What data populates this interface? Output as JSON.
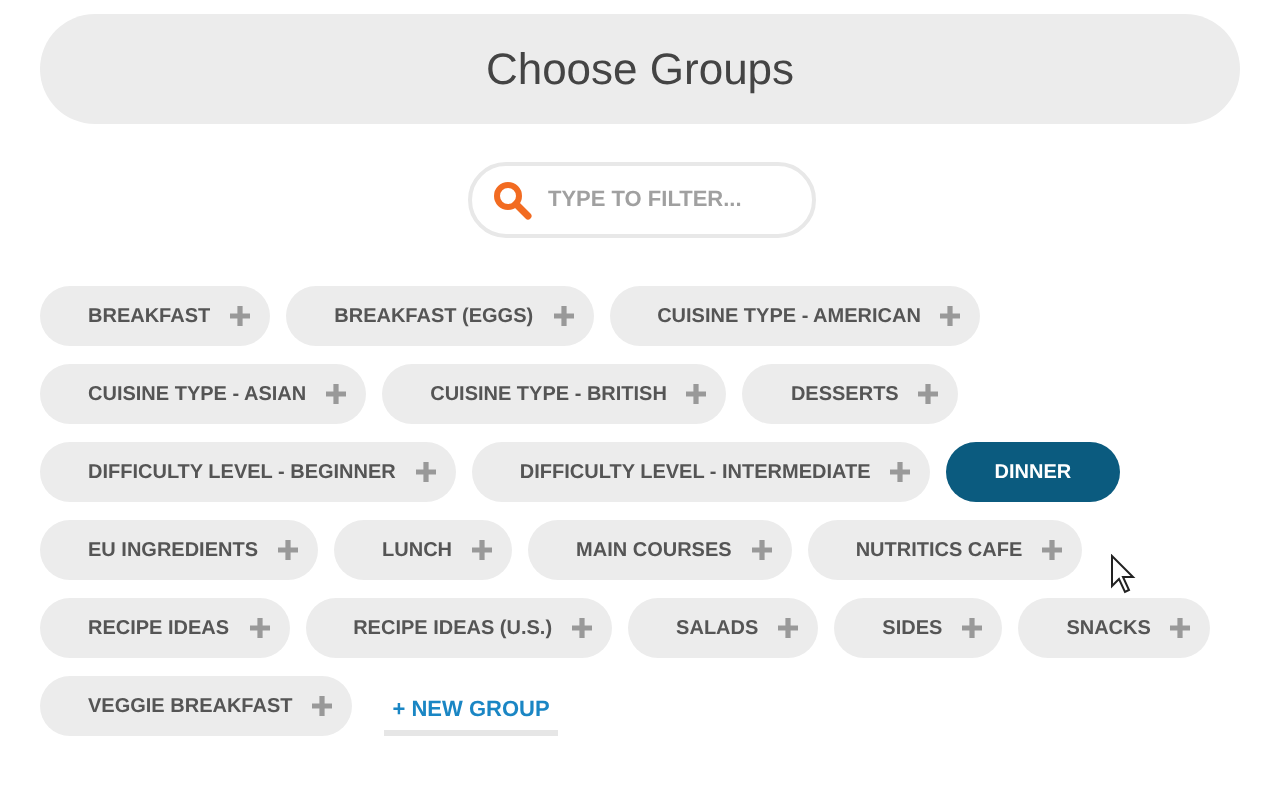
{
  "header": {
    "title": "Choose Groups"
  },
  "filter": {
    "placeholder": "TYPE TO FILTER..."
  },
  "groups": [
    {
      "label": "BREAKFAST",
      "selected": false
    },
    {
      "label": "BREAKFAST (EGGS)",
      "selected": false
    },
    {
      "label": "CUISINE TYPE - AMERICAN",
      "selected": false
    },
    {
      "label": "CUISINE TYPE - ASIAN",
      "selected": false
    },
    {
      "label": "CUISINE TYPE - BRITISH",
      "selected": false
    },
    {
      "label": "DESSERTS",
      "selected": false
    },
    {
      "label": "DIFFICULTY LEVEL - BEGINNER",
      "selected": false
    },
    {
      "label": "DIFFICULTY LEVEL - INTERMEDIATE",
      "selected": false
    },
    {
      "label": "DINNER",
      "selected": true
    },
    {
      "label": "EU INGREDIENTS",
      "selected": false
    },
    {
      "label": "LUNCH",
      "selected": false
    },
    {
      "label": "MAIN COURSES",
      "selected": false
    },
    {
      "label": "NUTRITICS CAFE",
      "selected": false
    },
    {
      "label": "RECIPE IDEAS",
      "selected": false
    },
    {
      "label": "RECIPE IDEAS (U.S.)",
      "selected": false
    },
    {
      "label": "SALADS",
      "selected": false
    },
    {
      "label": "SIDES",
      "selected": false
    },
    {
      "label": "SNACKS",
      "selected": false
    },
    {
      "label": "VEGGIE BREAKFAST",
      "selected": false
    }
  ],
  "new_group": {
    "label": "+ NEW GROUP"
  }
}
